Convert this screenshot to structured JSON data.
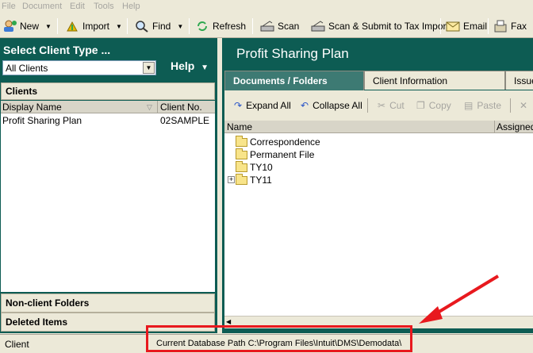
{
  "menu": [
    "File",
    "Document",
    "Edit",
    "Tools",
    "Help"
  ],
  "toolbar": {
    "new": "New",
    "import": "Import",
    "find": "Find",
    "refresh": "Refresh",
    "scan": "Scan",
    "scan_submit": "Scan & Submit to Tax Import",
    "email": "Email",
    "fax": "Fax"
  },
  "left": {
    "select_title": "Select Client Type ...",
    "client_type": "All Clients",
    "help": "Help",
    "clients_header": "Clients",
    "col_display": "Display Name",
    "col_client_no": "Client No.",
    "rows": [
      {
        "name": "Profit Sharing Plan",
        "no": "02SAMPLE"
      }
    ],
    "non_client": "Non-client Folders",
    "deleted": "Deleted Items"
  },
  "right": {
    "title": "Profit Sharing Plan",
    "tabs": [
      "Documents / Folders",
      "Client Information",
      "Issues"
    ],
    "actions": {
      "expand": "Expand All",
      "collapse": "Collapse All",
      "cut": "Cut",
      "copy": "Copy",
      "paste": "Paste"
    },
    "col_name": "Name",
    "col_assigned": "Assigned",
    "folders": [
      "Correspondence",
      "Permanent File",
      "TY10",
      "TY11"
    ]
  },
  "status": {
    "left": "Client",
    "path": "Current Database Path  C:\\Program Files\\Intuit\\DMS\\Demodata\\"
  },
  "colors": {
    "panel": "#0d5c53",
    "annotation": "#e8191e"
  }
}
